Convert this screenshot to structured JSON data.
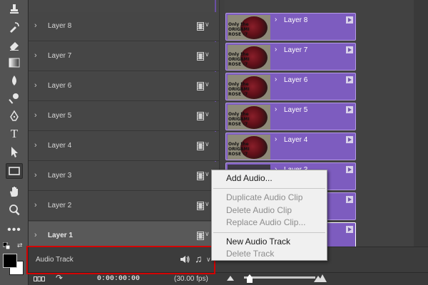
{
  "toolbar": {
    "tools": [
      {
        "icon": "clone-stamp-icon"
      },
      {
        "icon": "history-brush-icon"
      },
      {
        "icon": "eraser-icon"
      },
      {
        "icon": "gradient-icon"
      },
      {
        "icon": "blur-icon"
      },
      {
        "icon": "dodge-icon"
      },
      {
        "icon": "pen-icon"
      },
      {
        "icon": "type-icon"
      },
      {
        "icon": "path-selection-icon"
      },
      {
        "icon": "rectangle-icon",
        "active": true
      },
      {
        "icon": "hand-icon"
      },
      {
        "icon": "zoom-icon"
      },
      {
        "icon": "more-tools-icon"
      }
    ],
    "type_glyph": "T",
    "more_glyph": "•••",
    "foreground_color": "#000000",
    "background_color": "#ffffff"
  },
  "layers": [
    {
      "name": "Layer 8",
      "clip_label": "Layer 8"
    },
    {
      "name": "Layer 7",
      "clip_label": "Layer 7"
    },
    {
      "name": "Layer 6",
      "clip_label": "Layer 6"
    },
    {
      "name": "Layer 5",
      "clip_label": "Layer 5"
    },
    {
      "name": "Layer 4",
      "clip_label": "Layer 4"
    },
    {
      "name": "Layer 3",
      "clip_label": "Layer 3"
    },
    {
      "name": "Layer 2",
      "clip_label": ""
    },
    {
      "name": "Layer 1",
      "clip_label": "",
      "selected": true
    }
  ],
  "clip_thumb_text": "Only the\nORIGAMI\nROSE ♯7",
  "audio_track": {
    "label": "Audio Track",
    "note_glyph": "♫"
  },
  "glyphs": {
    "chevron": "›",
    "caret": "∨",
    "convert": "↷"
  },
  "bottom_bar": {
    "timecode": "0:00:00:00",
    "fps": "(30.00 fps)"
  },
  "context_menu": {
    "items": [
      {
        "label": "Add Audio...",
        "enabled": true
      },
      {
        "label": "Duplicate Audio Clip",
        "enabled": false
      },
      {
        "label": "Delete Audio Clip",
        "enabled": false
      },
      {
        "label": "Replace Audio Clip...",
        "enabled": false
      },
      {
        "label": "New Audio Track",
        "enabled": true
      },
      {
        "label": "Delete Track",
        "enabled": false
      }
    ]
  },
  "colors": {
    "clip": "#7d5cbf",
    "highlight": "#d40000",
    "panel": "#474747"
  }
}
